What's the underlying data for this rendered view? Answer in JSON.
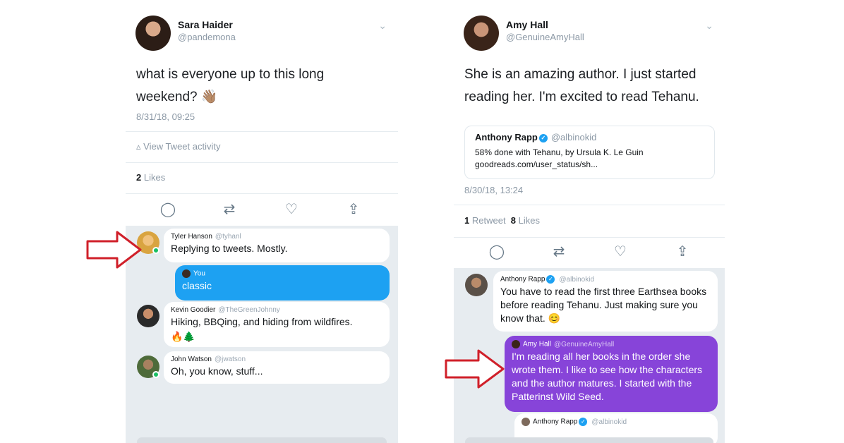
{
  "left": {
    "author_name": "Sara Haider",
    "author_handle": "@pandemona",
    "tweet_text": "what is everyone up to this long weekend? 👋🏽",
    "timestamp": "8/31/18, 09:25",
    "view_activity": "View Tweet activity",
    "likes_count": "2",
    "likes_label": "Likes",
    "thread": [
      {
        "name": "Tyler Hanson",
        "handle": "@tyhanl",
        "text": "Replying to tweets. Mostly."
      },
      {
        "name": "You",
        "handle": "",
        "text": "classic"
      },
      {
        "name": "Kevin Goodier",
        "handle": "@TheGreenJohnny",
        "text": "Hiking, BBQing, and hiding from wildfires.",
        "emoji": "🔥🌲"
      },
      {
        "name": "John Watson",
        "handle": "@jwatson",
        "text": "Oh, you know, stuff..."
      }
    ]
  },
  "right": {
    "author_name": "Amy Hall",
    "author_handle": "@GenuineAmyHall",
    "tweet_text": "She is an amazing author. I just started reading her.  I'm excited to read Tehanu.",
    "quote": {
      "name": "Anthony Rapp",
      "handle": "@albinokid",
      "text": "58% done with Tehanu, by Ursula K. Le Guin goodreads.com/user_status/sh..."
    },
    "timestamp": "8/30/18, 13:24",
    "retweets_count": "1",
    "retweets_label": "Retweet",
    "likes_count": "8",
    "likes_label": "Likes",
    "thread": [
      {
        "name": "Anthony Rapp",
        "handle": "@albinokid",
        "text": "You have to read the first three Earthsea books before reading Tehanu. Just making sure you know that. 😊"
      },
      {
        "name": "Amy Hall",
        "handle": "@GenuineAmyHall",
        "text": "I'm reading all her books in the order she wrote them.  I like to see how the characters and the author matures.  I started with the Patterinst Wild Seed."
      },
      {
        "name": "Anthony Rapp",
        "handle": "@albinokid",
        "text": ""
      }
    ]
  },
  "colors": {
    "twitter_blue": "#1da1f2",
    "dm_purple": "#8744d9",
    "thread_bg": "#e7ecf0",
    "arrow_red": "#d0202a",
    "online_green": "#17bf63"
  },
  "icons": [
    "chevron-down-icon",
    "reply-icon",
    "retweet-icon",
    "like-icon",
    "share-icon",
    "stats-icon",
    "verified-icon",
    "red-arrow-icon"
  ]
}
